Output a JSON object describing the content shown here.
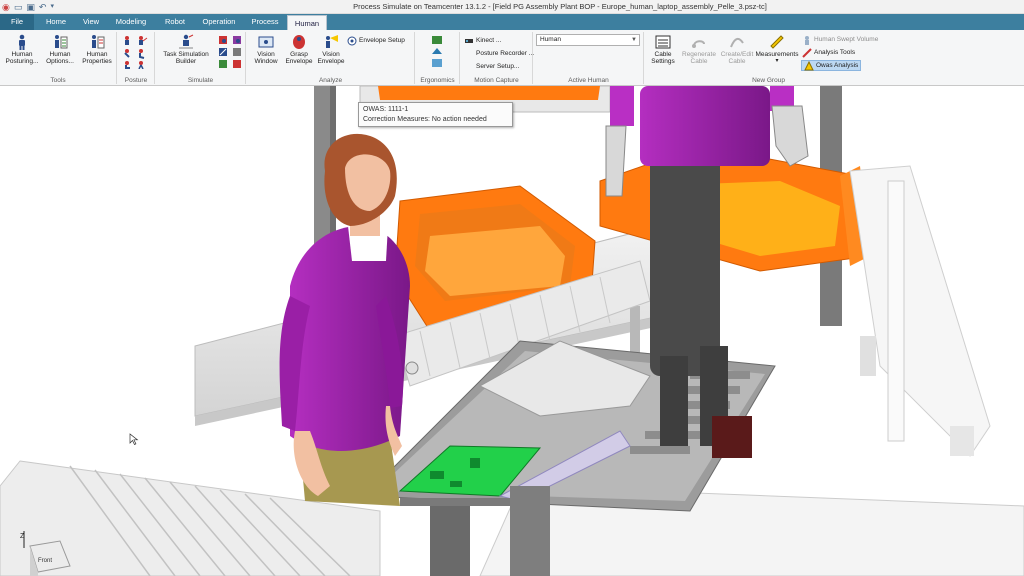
{
  "window": {
    "title": "Process Simulate on Teamcenter 13.1.2 - [Field PG Assembly Plant BOP - Europe_human_laptop_assembly_Pelle_3.psz-tc]"
  },
  "quick_access": {
    "icons": [
      "app-logo-icon",
      "open-icon",
      "save-icon",
      "undo-icon",
      "qa-dropdown-icon"
    ]
  },
  "menu_tabs": [
    "File",
    "Home",
    "View",
    "Modeling",
    "Robot",
    "Operation",
    "Process",
    "Human"
  ],
  "active_tab": "Human",
  "ribbon": {
    "tools": {
      "label": "Tools",
      "human_posturing": "Human Posturing...",
      "human_options": "Human Options...",
      "human_properties": "Human Properties"
    },
    "posture": {
      "label": "Posture"
    },
    "simulate": {
      "label": "Simulate",
      "task_simulation_builder": "Task Simulation Builder"
    },
    "analyze": {
      "label": "Analyze",
      "vision_window": "Vision Window",
      "grasp_envelope": "Grasp Envelope",
      "vision_envelope": "Vision Envelope",
      "envelope_setup": "Envelope Setup"
    },
    "ergonomics": {
      "label": "Ergonomics"
    },
    "motion_capture": {
      "label": "Motion Capture",
      "kinect": "Kinect ...",
      "posture_recorder": "Posture Recorder ...",
      "server_setup": "Server Setup..."
    },
    "active_human": {
      "label": "Active Human",
      "selected": "Human"
    },
    "new_group": {
      "label": "New Group",
      "cable_settings": "Cable Settings",
      "regenerate_cable": "Regenerate Cable",
      "create_edit_cable": "Create/Edit Cable",
      "measurements": "Measurements",
      "human_swept_volume": "Human Swept Volume",
      "analysis_tools": "Analysis Tools",
      "owas_analysis": "Owas Analysis"
    }
  },
  "tooltip": {
    "owas_line": "OWAS: 1111-1",
    "correction_line": "Correction Measures: No action needed"
  },
  "colors": {
    "tab_bar": "#3d7f9f",
    "file_tab": "#2b6887",
    "ribbon_bg": "#f5f6f7",
    "orange_bin": "#ff7a10",
    "shirt_purple": "#9a1fa6",
    "pcb_green": "#22d04a"
  },
  "scene_objects": [
    "left-worker",
    "right-worker",
    "orange-bins",
    "roller-conveyor",
    "laptop-fixture",
    "workbench",
    "frame",
    "view-cube"
  ]
}
